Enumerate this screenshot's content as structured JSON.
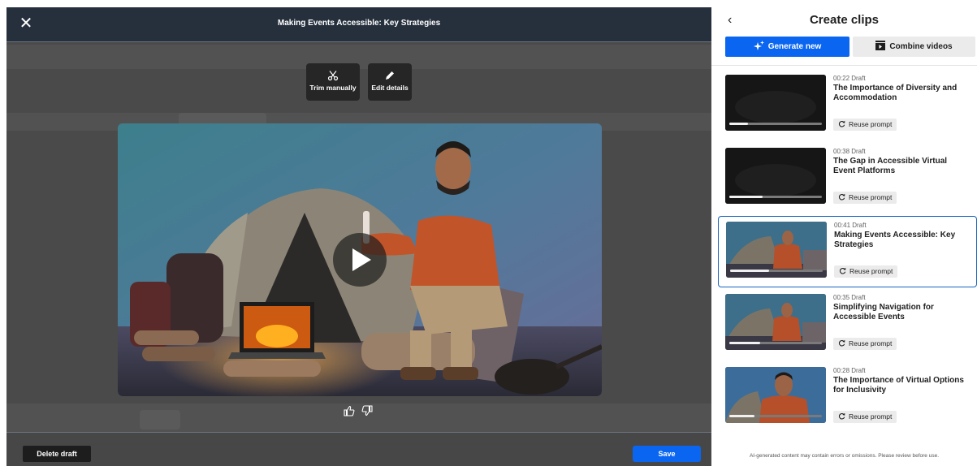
{
  "editor": {
    "title": "Making Events Accessible: Key Strategies",
    "close_icon": "close-icon",
    "tools": {
      "trim_label": "Trim manually",
      "edit_label": "Edit details"
    },
    "feedback": {
      "like_icon": "thumbs-up-icon",
      "dislike_icon": "thumbs-down-icon"
    },
    "delete_label": "Delete draft",
    "save_label": "Save"
  },
  "panel": {
    "title": "Create clips",
    "back_icon": "chevron-left-icon",
    "generate_label": "Generate new",
    "combine_label": "Combine videos",
    "reuse_label": "Reuse prompt",
    "disclaimer": "AI-generated content may contain errors or omissions. Please review before use.",
    "clips": [
      {
        "meta": "00:22 Draft",
        "title": "The Importance of Diversity and Accommodation",
        "progress": 0.2,
        "selected": false,
        "thumb": "dark"
      },
      {
        "meta": "00:38 Draft",
        "title": "The Gap in Accessible Virtual Event Platforms",
        "progress": 0.36,
        "selected": false,
        "thumb": "dark"
      },
      {
        "meta": "00:41 Draft",
        "title": "Making Events Accessible: Key Strategies",
        "progress": 0.42,
        "selected": true,
        "thumb": "scene"
      },
      {
        "meta": "00:35 Draft",
        "title": "Simplifying Navigation for Accessible Events",
        "progress": 0.33,
        "selected": false,
        "thumb": "scene"
      },
      {
        "meta": "00:28 Draft",
        "title": "The Importance of Virtual Options for Inclusivity",
        "progress": 0.27,
        "selected": false,
        "thumb": "scene-close"
      }
    ]
  },
  "colors": {
    "accent": "#0a66f0",
    "topbar": "#26303d",
    "selected_border": "#1565c0"
  }
}
